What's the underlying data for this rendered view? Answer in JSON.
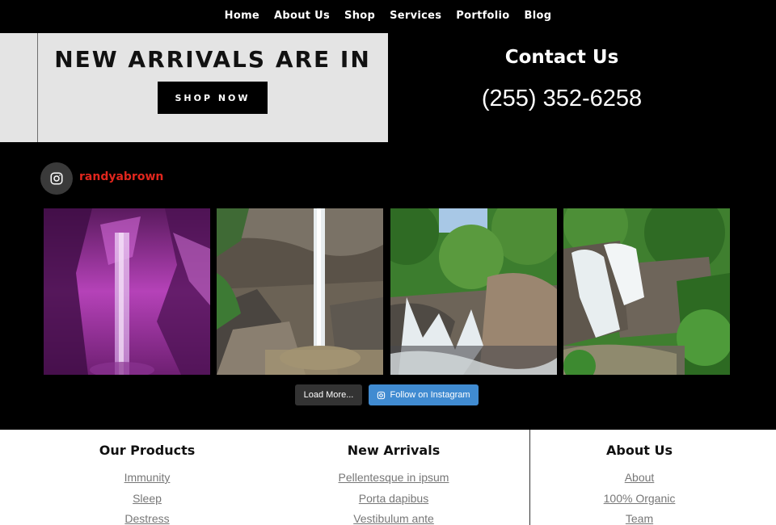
{
  "nav": {
    "items": [
      {
        "label": "Home"
      },
      {
        "label": "About Us"
      },
      {
        "label": "Shop"
      },
      {
        "label": "Services"
      },
      {
        "label": "Portfolio"
      },
      {
        "label": "Blog"
      }
    ]
  },
  "promo": {
    "title": "NEW ARRIVALS ARE IN",
    "button_label": "SHOP NOW"
  },
  "contact": {
    "title": "Contact Us",
    "phone": "(255) 352-6258"
  },
  "instagram": {
    "username": "randyabrown",
    "icon": "instagram-icon",
    "photos": [
      {
        "alt": "Illuminated purple cave waterfall"
      },
      {
        "alt": "Tall waterfall over rock cliff"
      },
      {
        "alt": "Cascades over boulders in forest"
      },
      {
        "alt": "Wide waterfall with green foliage"
      }
    ],
    "load_more_label": "Load More...",
    "follow_label": "Follow on Instagram"
  },
  "footer": {
    "columns": [
      {
        "title": "Our Products",
        "links": [
          "Immunity",
          "Sleep",
          "Destress"
        ]
      },
      {
        "title": "New Arrivals",
        "links": [
          "Pellentesque in ipsum",
          "Porta dapibus",
          "Vestibulum ante"
        ]
      },
      {
        "title": "About Us",
        "links": [
          "About",
          "100% Organic",
          "Team"
        ]
      }
    ]
  },
  "colors": {
    "background": "#000000",
    "promo_bg": "#e4e4e4",
    "username": "#e0261d",
    "follow_button": "#408bd1",
    "load_button": "#333333",
    "footer_link": "#777777"
  }
}
